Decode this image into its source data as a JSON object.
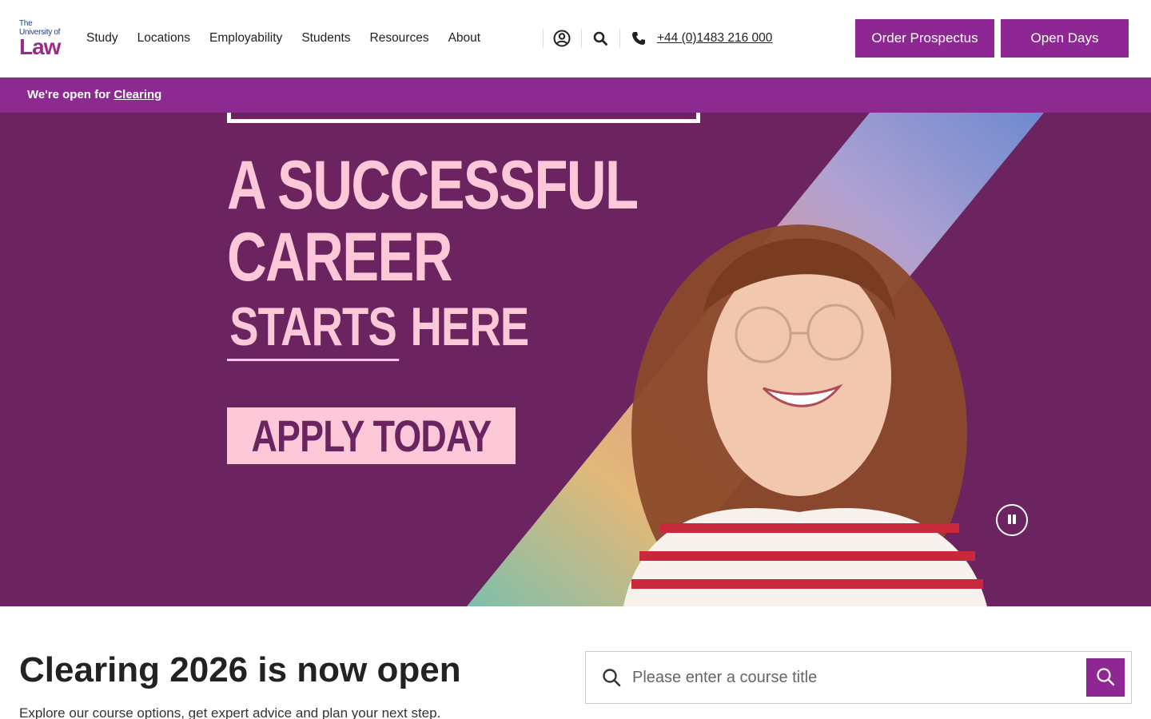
{
  "logo": {
    "line1": "The",
    "line2": "University of",
    "line3": "Law"
  },
  "nav": {
    "items": [
      {
        "label": "Study"
      },
      {
        "label": "Locations"
      },
      {
        "label": "Employability"
      },
      {
        "label": "Students"
      },
      {
        "label": "Resources"
      },
      {
        "label": "About"
      }
    ],
    "account_icon": "user-circle-icon",
    "search_icon": "search-icon",
    "phone_icon": "phone-icon",
    "phone": "+44 (0)1483 216 000"
  },
  "buttons": {
    "prospectus": "Order Prospectus",
    "open_days": "Open Days"
  },
  "banner": {
    "prefix": "We're open for ",
    "link": "Clearing"
  },
  "hero": {
    "line1": "A SUCCESSFUL",
    "line2": "CAREER",
    "line3_underlined": "STARTS",
    "line3_rest": " HERE",
    "cta": "APPLY TODAY",
    "pause_icon": "pause-icon"
  },
  "section": {
    "title": "Clearing 2026 is now open",
    "subtitle": "Explore our course options, get expert advice and plan your next step."
  },
  "search": {
    "placeholder": "Please enter a course title",
    "value": ""
  },
  "colors": {
    "brand_purple": "#8e2793",
    "hero_bg": "#6b245f",
    "hero_text": "#ffc8d8"
  }
}
